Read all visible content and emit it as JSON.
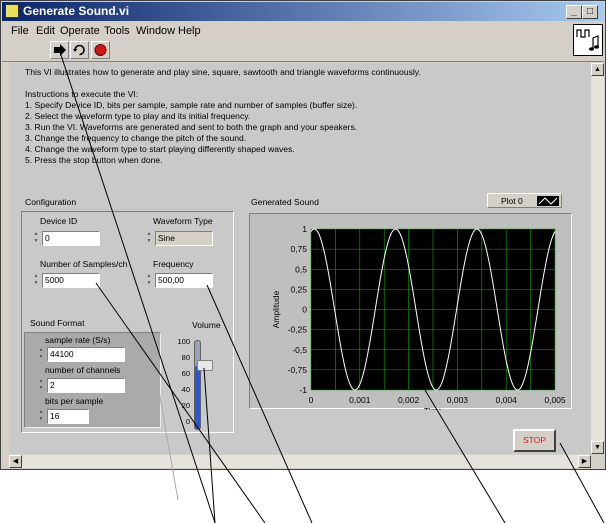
{
  "window": {
    "title": "Generate Sound.vi",
    "controls": {
      "minimize": "_",
      "maximize": "□",
      "close": "X"
    }
  },
  "menu": [
    "File",
    "Edit",
    "Operate",
    "Tools",
    "Window",
    "Help"
  ],
  "toolbar": {
    "icons": [
      "run-arrow-icon",
      "run-continuously-icon",
      "abort-icon"
    ]
  },
  "instructions": {
    "intro": "This VI illustrates how to generate and play sine, square, sawtooth and triangle waveforms continuously.",
    "heading": "Instructions to execute the VI:",
    "steps": [
      "1.  Specify Device ID, bits per sample, sample rate and number of samples (buffer size).",
      "2.  Select the waveform type to play and its initial frequency.",
      "3.  Run the VI. Waveforms are generated and sent to both the graph and your speakers.",
      "3.  Change the frequency to change the pitch of the sound.",
      "4.  Change the waveform type to start playing differently shaped waves.",
      "5.  Press the stop button when done."
    ]
  },
  "config": {
    "title": "Configuration",
    "device_id": {
      "label": "Device ID",
      "value": "0"
    },
    "waveform_type": {
      "label": "Waveform Type",
      "value": "Sine"
    },
    "num_samples": {
      "label": "Number of Samples/ch",
      "value": "5000"
    },
    "frequency": {
      "label": "Frequency",
      "value": "500,00"
    },
    "sound_format": {
      "title": "Sound Format",
      "sample_rate": {
        "label": "sample rate (S/s)",
        "value": "44100"
      },
      "channels": {
        "label": "number of channels",
        "value": "2"
      },
      "bits": {
        "label": "bits per sample",
        "value": "16"
      }
    },
    "volume": {
      "label": "Volume",
      "ticks": [
        "100",
        "80",
        "60",
        "40",
        "20",
        "0"
      ],
      "level": 72
    }
  },
  "graph": {
    "title": "Generated Sound",
    "legend": "Plot 0",
    "y_ticks": [
      "1",
      "0,75",
      "0,5",
      "0,25",
      "0",
      "-0,25",
      "-0,5",
      "-0,75",
      "-1"
    ],
    "x_ticks": [
      "0",
      "0,001",
      "0,002",
      "0,003",
      "0,004",
      "0,005"
    ],
    "xlabel": "Time",
    "ylabel": "Amplitude"
  },
  "chart_data": {
    "type": "line",
    "title": "Generated Sound",
    "xlabel": "Time",
    "ylabel": "Amplitude",
    "xlim": [
      0,
      0.005
    ],
    "ylim": [
      -1,
      1
    ],
    "grid": true,
    "series": [
      {
        "name": "Plot 0",
        "function": "sine",
        "frequency": 600,
        "phase_offset": 0.21
      }
    ]
  },
  "stop_button": {
    "label": "STOP"
  },
  "colors": {
    "plot_bg": "#000000",
    "grid": "#16a316",
    "trace": "#ffffff",
    "stop_text": "#e31818"
  }
}
